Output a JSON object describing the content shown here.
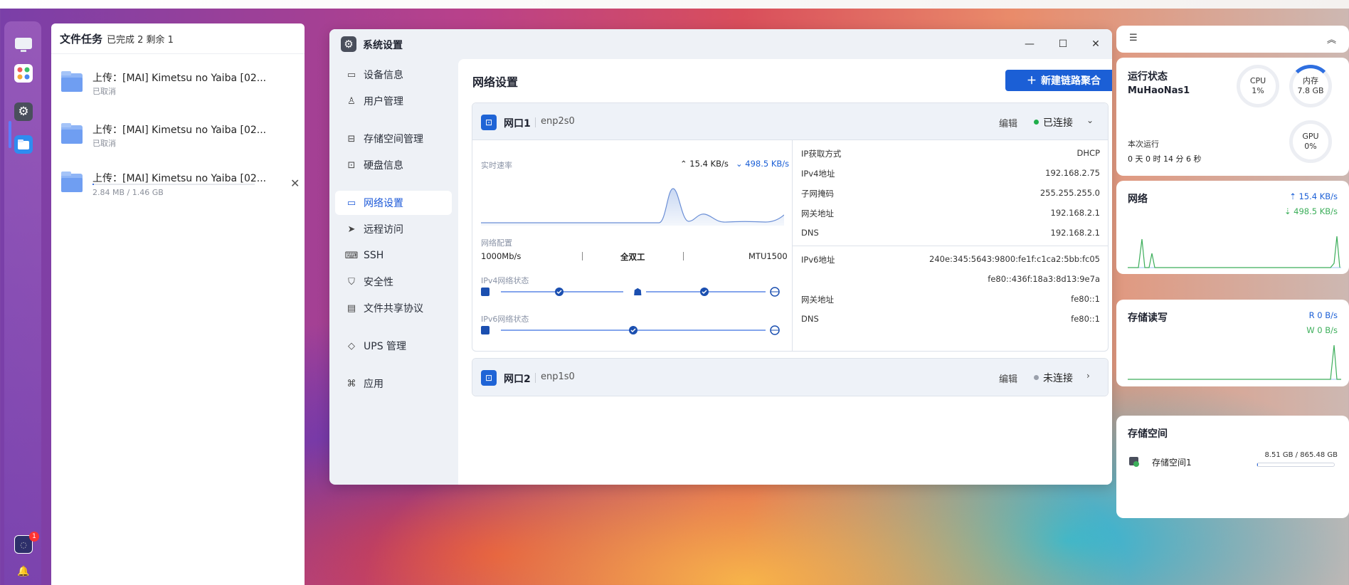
{
  "dock": {
    "items": [
      {
        "name": "desktop-icon"
      },
      {
        "name": "apps-icon"
      },
      {
        "name": "settings-icon"
      },
      {
        "name": "files-icon"
      }
    ],
    "notification_badge": "1"
  },
  "tasks": {
    "title": "文件任务",
    "summary": "已完成 2 剩余 1",
    "items": [
      {
        "name": "上传：[MAI] Kimetsu no Yaiba [02...",
        "status": "已取消"
      },
      {
        "name": "上传：[MAI] Kimetsu no Yaiba [02...",
        "status": "已取消"
      },
      {
        "name": "上传：[MAI] Kimetsu no Yaiba [02...",
        "status": "2.84 MB / 1.46 GB",
        "progress": 0.002
      }
    ]
  },
  "window": {
    "title": "系统设置",
    "sidebar": [
      {
        "label": "设备信息",
        "icon": "device-icon"
      },
      {
        "label": "用户管理",
        "icon": "user-icon"
      },
      {
        "label": "存储空间管理",
        "icon": "storage-icon"
      },
      {
        "label": "硬盘信息",
        "icon": "disk-icon"
      },
      {
        "label": "网络设置",
        "icon": "network-icon",
        "active": true
      },
      {
        "label": "远程访问",
        "icon": "remote-icon"
      },
      {
        "label": "SSH",
        "icon": "terminal-icon"
      },
      {
        "label": "安全性",
        "icon": "shield-icon"
      },
      {
        "label": "文件共享协议",
        "icon": "file-icon"
      },
      {
        "label": "UPS 管理",
        "icon": "ups-icon"
      },
      {
        "label": "应用",
        "icon": "apps-icon"
      }
    ],
    "content": {
      "title": "网络设置",
      "new_button": "新建链路聚合",
      "ports": [
        {
          "name": "网口1",
          "device": "enp2s0",
          "edit": "编辑",
          "state": "已连接",
          "state_color": "#1fae4a",
          "realtime_label": "实时速率",
          "up": "15.4 KB/s",
          "down": "498.5 KB/s",
          "config_label": "网络配置",
          "speed": "1000Mb/s",
          "duplex": "全双工",
          "mtu": "MTU1500",
          "ipv4_status_label": "IPv4网络状态",
          "ipv6_status_label": "IPv6网络状态",
          "ipv4": {
            "rows": [
              {
                "k": "IP获取方式",
                "v": "DHCP"
              },
              {
                "k": "IPv4地址",
                "v": "192.168.2.75"
              },
              {
                "k": "子网掩码",
                "v": "255.255.255.0"
              },
              {
                "k": "网关地址",
                "v": "192.168.2.1"
              },
              {
                "k": "DNS",
                "v": "192.168.2.1"
              }
            ]
          },
          "ipv6": {
            "rows": [
              {
                "k": "IPv6地址",
                "v": "240e:345:5643:9800:fe1f:c1ca2:5bb:fc05"
              },
              {
                "k": "",
                "v": "fe80::436f:18a3:8d13:9e7a"
              },
              {
                "k": "网关地址",
                "v": "fe80::1"
              },
              {
                "k": "DNS",
                "v": "fe80::1"
              }
            ]
          }
        },
        {
          "name": "网口2",
          "device": "enp1s0",
          "edit": "编辑",
          "state": "未连接",
          "state_color": "#9aa0ab"
        }
      ]
    }
  },
  "dashboard": {
    "status": {
      "title": "运行状态",
      "host": "MuHaoNas1",
      "uptime_label": "本次运行",
      "uptime": "0 天 0 时 14 分 6 秒",
      "cpu_label": "CPU",
      "cpu_value": "1%",
      "cpu_fraction": 0.01,
      "mem_label": "内存",
      "mem_value": "7.8 GB",
      "mem_fraction": 0.2,
      "gpu_label": "GPU",
      "gpu_value": "0%"
    },
    "network": {
      "title": "网络",
      "up": "15.4 KB/s",
      "down": "498.5 KB/s",
      "up_color": "#1b5fd6",
      "down_color": "#3cae5a"
    },
    "disk_io": {
      "title": "存储读写",
      "read": "R  0 B/s",
      "write": "W  0 B/s"
    },
    "storage": {
      "title": "存储空间",
      "pool": "存储空间1",
      "usage": "8.51 GB / 865.48 GB",
      "fraction": 0.01
    }
  }
}
